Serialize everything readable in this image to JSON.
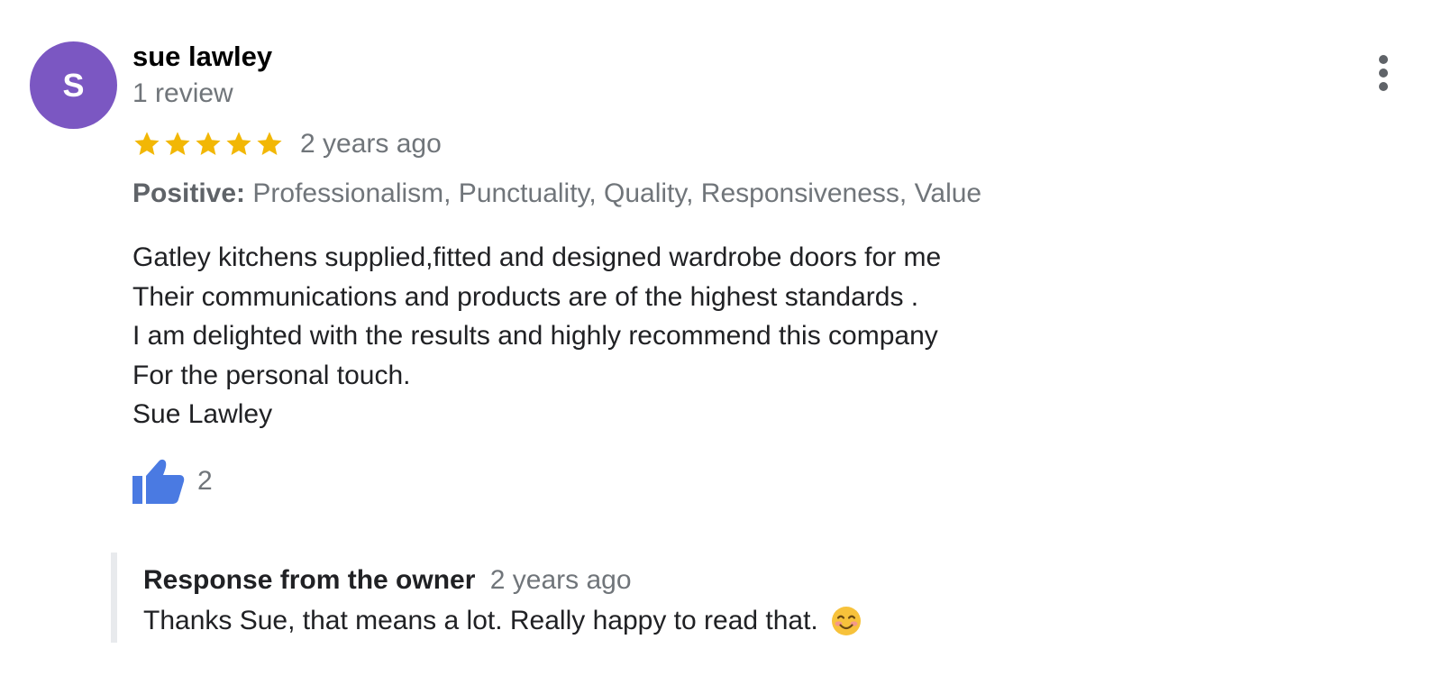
{
  "review": {
    "avatar_initial": "S",
    "avatar_color": "#7b57c2",
    "reviewer_name": "sue lawley",
    "review_count": "1 review",
    "rating": 5,
    "rating_max": 5,
    "star_color": "#f2b705",
    "date": "2 years ago",
    "positive_label": "Positive:",
    "positive_values": "Professionalism, Punctuality, Quality, Responsiveness, Value",
    "text_lines": [
      "Gatley kitchens supplied,fitted and designed wardrobe doors for me",
      "Their communications and products are of the highest standards .",
      "I am delighted with the results and highly recommend this company",
      "For the personal touch.",
      "Sue Lawley"
    ],
    "like_count": "2",
    "like_icon_color": "#4a7ae2"
  },
  "owner_response": {
    "title": "Response from the owner",
    "date": "2 years ago",
    "text": "Thanks Sue, that means a lot. Really happy to read that.",
    "emoji": "smiling-face-icon"
  },
  "icons": {
    "more": "more-vert-icon",
    "star": "star-icon",
    "like": "thumbs-up-icon"
  }
}
